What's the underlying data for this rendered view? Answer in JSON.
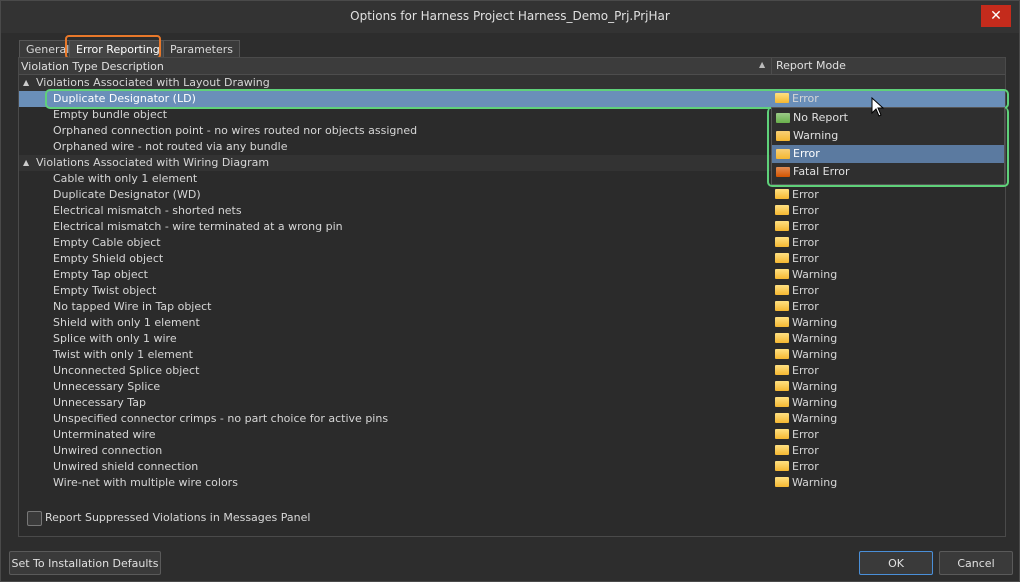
{
  "window": {
    "title": "Options for Harness Project Harness_Demo_Prj.PrjHar",
    "close_glyph": "✕"
  },
  "tabs": [
    {
      "label": "General"
    },
    {
      "label": "Error Reporting"
    },
    {
      "label": "Parameters"
    }
  ],
  "table": {
    "col_description": "Violation Type Description",
    "col_mode": "Report Mode",
    "groups": [
      {
        "label": "Violations Associated with Layout Drawing",
        "rows": [
          {
            "desc": "Duplicate Designator (LD)",
            "mode": "Error"
          },
          {
            "desc": "Empty bundle object",
            "mode": ""
          },
          {
            "desc": "Orphaned connection point - no wires routed nor objects assigned",
            "mode": ""
          },
          {
            "desc": "Orphaned wire - not routed via any bundle",
            "mode": ""
          }
        ]
      },
      {
        "label": "Violations Associated with Wiring Diagram",
        "rows": [
          {
            "desc": "Cable with only 1 element",
            "mode": "Warning"
          },
          {
            "desc": "Duplicate Designator (WD)",
            "mode": "Error"
          },
          {
            "desc": "Electrical mismatch - shorted nets",
            "mode": "Error"
          },
          {
            "desc": "Electrical mismatch - wire terminated at a wrong pin",
            "mode": "Error"
          },
          {
            "desc": "Empty Cable object",
            "mode": "Error"
          },
          {
            "desc": "Empty Shield object",
            "mode": "Error"
          },
          {
            "desc": "Empty Tap object",
            "mode": "Warning"
          },
          {
            "desc": "Empty Twist object",
            "mode": "Error"
          },
          {
            "desc": "No tapped Wire in Tap object",
            "mode": "Error"
          },
          {
            "desc": "Shield with only 1 element",
            "mode": "Warning"
          },
          {
            "desc": "Splice with only 1 wire",
            "mode": "Warning"
          },
          {
            "desc": "Twist with only 1 element",
            "mode": "Warning"
          },
          {
            "desc": "Unconnected Splice object",
            "mode": "Error"
          },
          {
            "desc": "Unnecessary Splice",
            "mode": "Warning"
          },
          {
            "desc": "Unnecessary Tap",
            "mode": "Warning"
          },
          {
            "desc": "Unspecified connector crimps - no part choice for active pins",
            "mode": "Warning"
          },
          {
            "desc": "Unterminated wire",
            "mode": "Error"
          },
          {
            "desc": "Unwired connection",
            "mode": "Error"
          },
          {
            "desc": "Unwired shield connection",
            "mode": "Error"
          },
          {
            "desc": "Wire-net with multiple wire colors",
            "mode": "Warning"
          }
        ]
      }
    ]
  },
  "dropdown": {
    "options": [
      {
        "label": "No Report",
        "color": "#6ab04c"
      },
      {
        "label": "Warning",
        "color": "#f5b731"
      },
      {
        "label": "Error",
        "color": "#f5b731"
      },
      {
        "label": "Fatal Error",
        "color": "#d35400"
      }
    ],
    "selected": "Error"
  },
  "footer": {
    "checkbox_label": "Report Suppressed Violations in Messages Panel",
    "defaults_button": "Set To Installation Defaults",
    "ok_button": "OK",
    "cancel_button": "Cancel"
  },
  "colors": {
    "tab_highlight": "#e8782a",
    "callout_highlight": "#5fd17a",
    "selection": "#6a8fb9",
    "close_button": "#c42b1c"
  }
}
